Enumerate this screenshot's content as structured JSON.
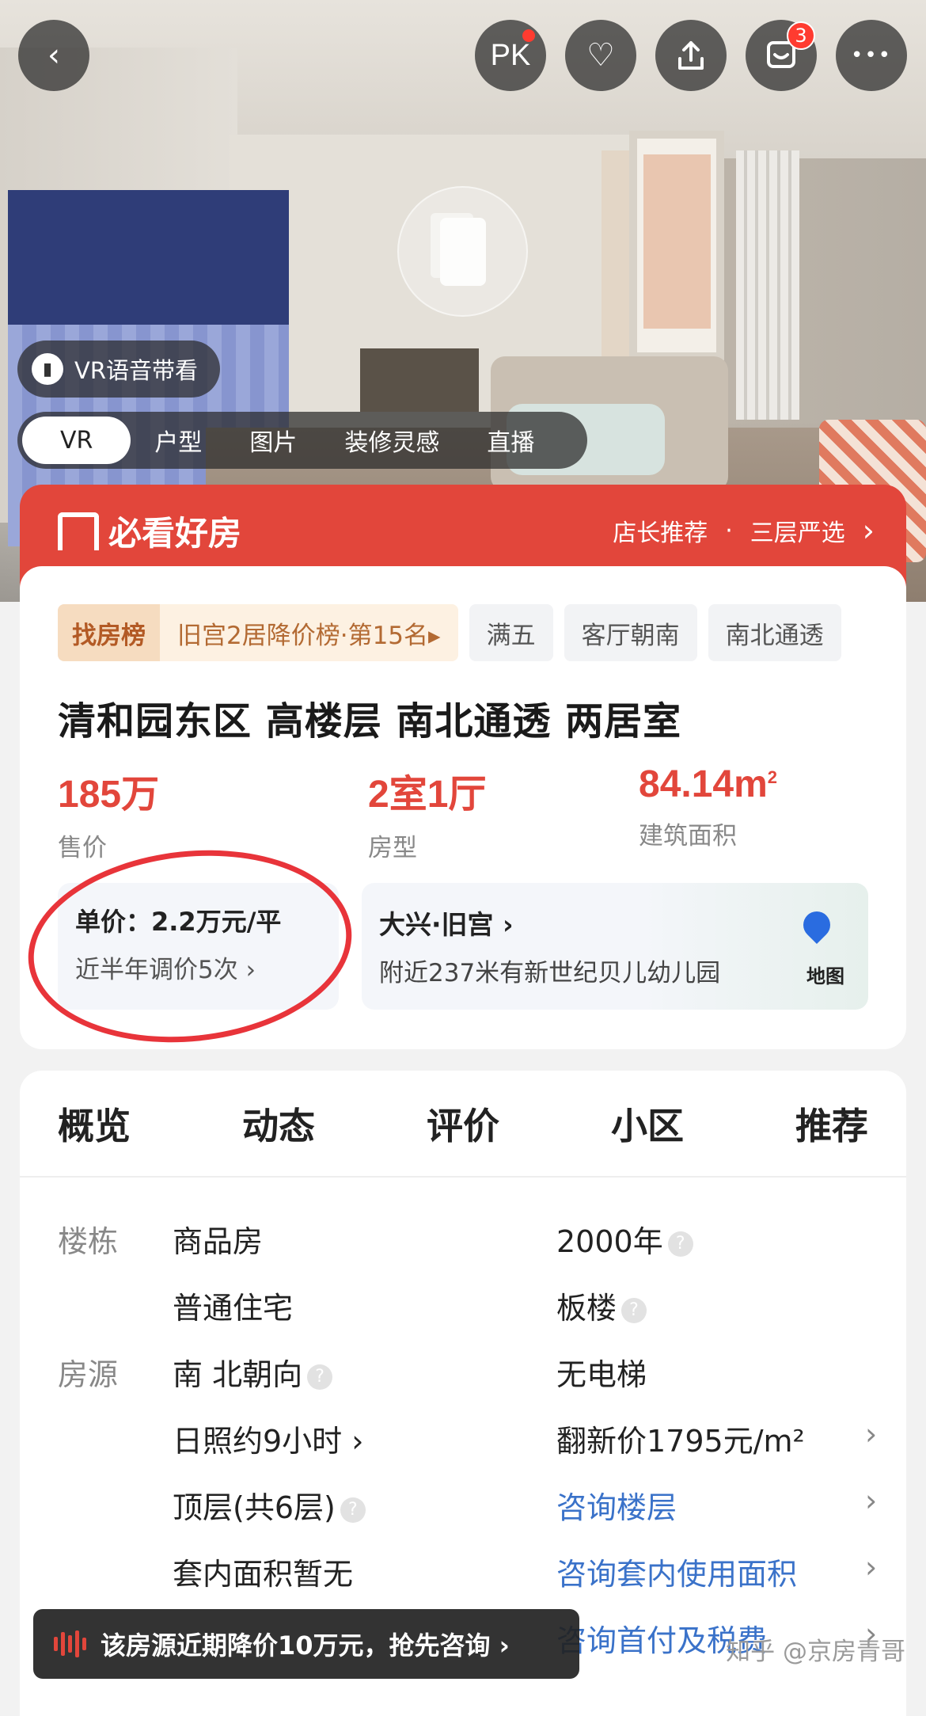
{
  "hero": {
    "top_buttons": {
      "back": "‹",
      "pk": "PK",
      "favorite": "♡",
      "share": "⇪",
      "messages_badge": "3",
      "more": "•••"
    },
    "vr_voice_label": "VR语音带看",
    "media_tabs": [
      "VR",
      "户型",
      "图片",
      "装修灵感",
      "直播"
    ]
  },
  "banner": {
    "brand": "必看好房",
    "link1": "店长推荐",
    "separator": "·",
    "link2": "三层严选",
    "chevron": "›"
  },
  "listing": {
    "rank_tag_left": "找房榜",
    "rank_tag_right": "旧宫2居降价榜·第15名▸",
    "tags": [
      "满五",
      "客厅朝南",
      "南北通透"
    ],
    "title": "清和园东区 高楼层 南北通透 两居室",
    "price_value": "185万",
    "price_label": "售价",
    "layout_value": "2室1厅",
    "layout_label": "房型",
    "area_value": "84.14m",
    "area_sup": "2",
    "area_label": "建筑面积",
    "unit_price": "单价：2.2万元/平",
    "price_adjust": "近半年调价5次 ›",
    "location": "大兴·旧宫 ›",
    "nearby": "附近237米有新世纪贝儿幼儿园",
    "map_label": "地图"
  },
  "section_tabs": [
    "概览",
    "动态",
    "评价",
    "小区",
    "推荐"
  ],
  "info": {
    "cat_building": "楼栋",
    "cat_source": "房源",
    "r1c1": "商品房",
    "r1c2": "2000年",
    "r2c1": "普通住宅",
    "r2c2": "板楼",
    "r3c1": "南 北朝向",
    "r3c2": "无电梯",
    "r4c1": "日照约9小时 ›",
    "r4c2": "翻新价1795元/m²",
    "r5c1": "顶层(共6层)",
    "r5c2": "咨询楼层",
    "r6c1": "套内面积暂无",
    "r6c2": "咨询套内使用面积",
    "r7c2": "咨询首付及税费",
    "chev": "›",
    "q": "?"
  },
  "toast": "该房源近期降价10万元，抢先咨询 ›",
  "watermark": "知乎 @京房青哥",
  "colors": {
    "accent_red": "#e2463b",
    "link_blue": "#3a72c9",
    "annotation_red": "#e8343a"
  }
}
